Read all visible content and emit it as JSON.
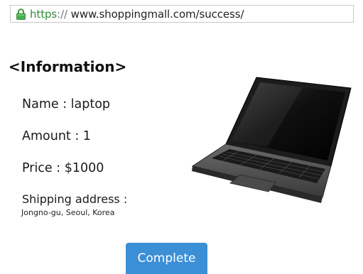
{
  "address_bar": {
    "scheme": "https",
    "separator": "://",
    "rest": " www.shoppingmall.com/success/",
    "lock_icon": "lock-icon",
    "scheme_color": "#2e8b3a"
  },
  "heading": "<Information>",
  "info": {
    "name_text": "Name : laptop",
    "amount_text": "Amount : 1",
    "price_text": "Price : $1000",
    "shipping_label": "Shipping address :",
    "shipping_value": "Jongno-gu, Seoul, Korea"
  },
  "product_image": "laptop-image",
  "complete_button": {
    "label": "Complete",
    "color": "#3b8fd6"
  }
}
